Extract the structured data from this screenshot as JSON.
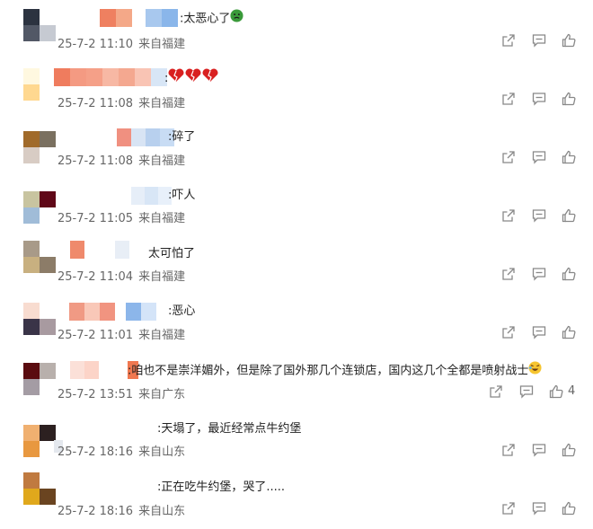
{
  "comments": [
    {
      "text": ":太恶心了",
      "time": "25-7-2 11:10",
      "location": "来自福建"
    },
    {
      "text": ":",
      "time": "25-7-2 11:08",
      "location": "来自福建"
    },
    {
      "text": ":碎了",
      "time": "25-7-2 11:08",
      "location": "来自福建"
    },
    {
      "text": ":吓人",
      "time": "25-7-2 11:05",
      "location": "来自福建"
    },
    {
      "text": "太可怕了",
      "time": "25-7-2 11:04",
      "location": "来自福建"
    },
    {
      "text": ":恶心",
      "time": "25-7-2 11:01",
      "location": "来自福建"
    },
    {
      "text": ":咱也不是崇洋媚外，但是除了国外那几个连锁店，国内这几个全都是喷射战士",
      "time": "25-7-2 13:51",
      "location": "来自广东",
      "likes": "4"
    },
    {
      "text": ":天塌了，最近经常点牛约堡",
      "time": "25-7-2 18:16",
      "location": "来自山东"
    },
    {
      "text": ":正在吃牛约堡，哭了.....",
      "time": "25-7-2 18:16",
      "location": "来自山东"
    }
  ],
  "icons": {
    "share": "share-icon",
    "reply": "reply-icon",
    "like": "like-icon"
  },
  "colors": {
    "icon": "#888888",
    "meta_text": "#666666",
    "content_text": "#222222"
  }
}
